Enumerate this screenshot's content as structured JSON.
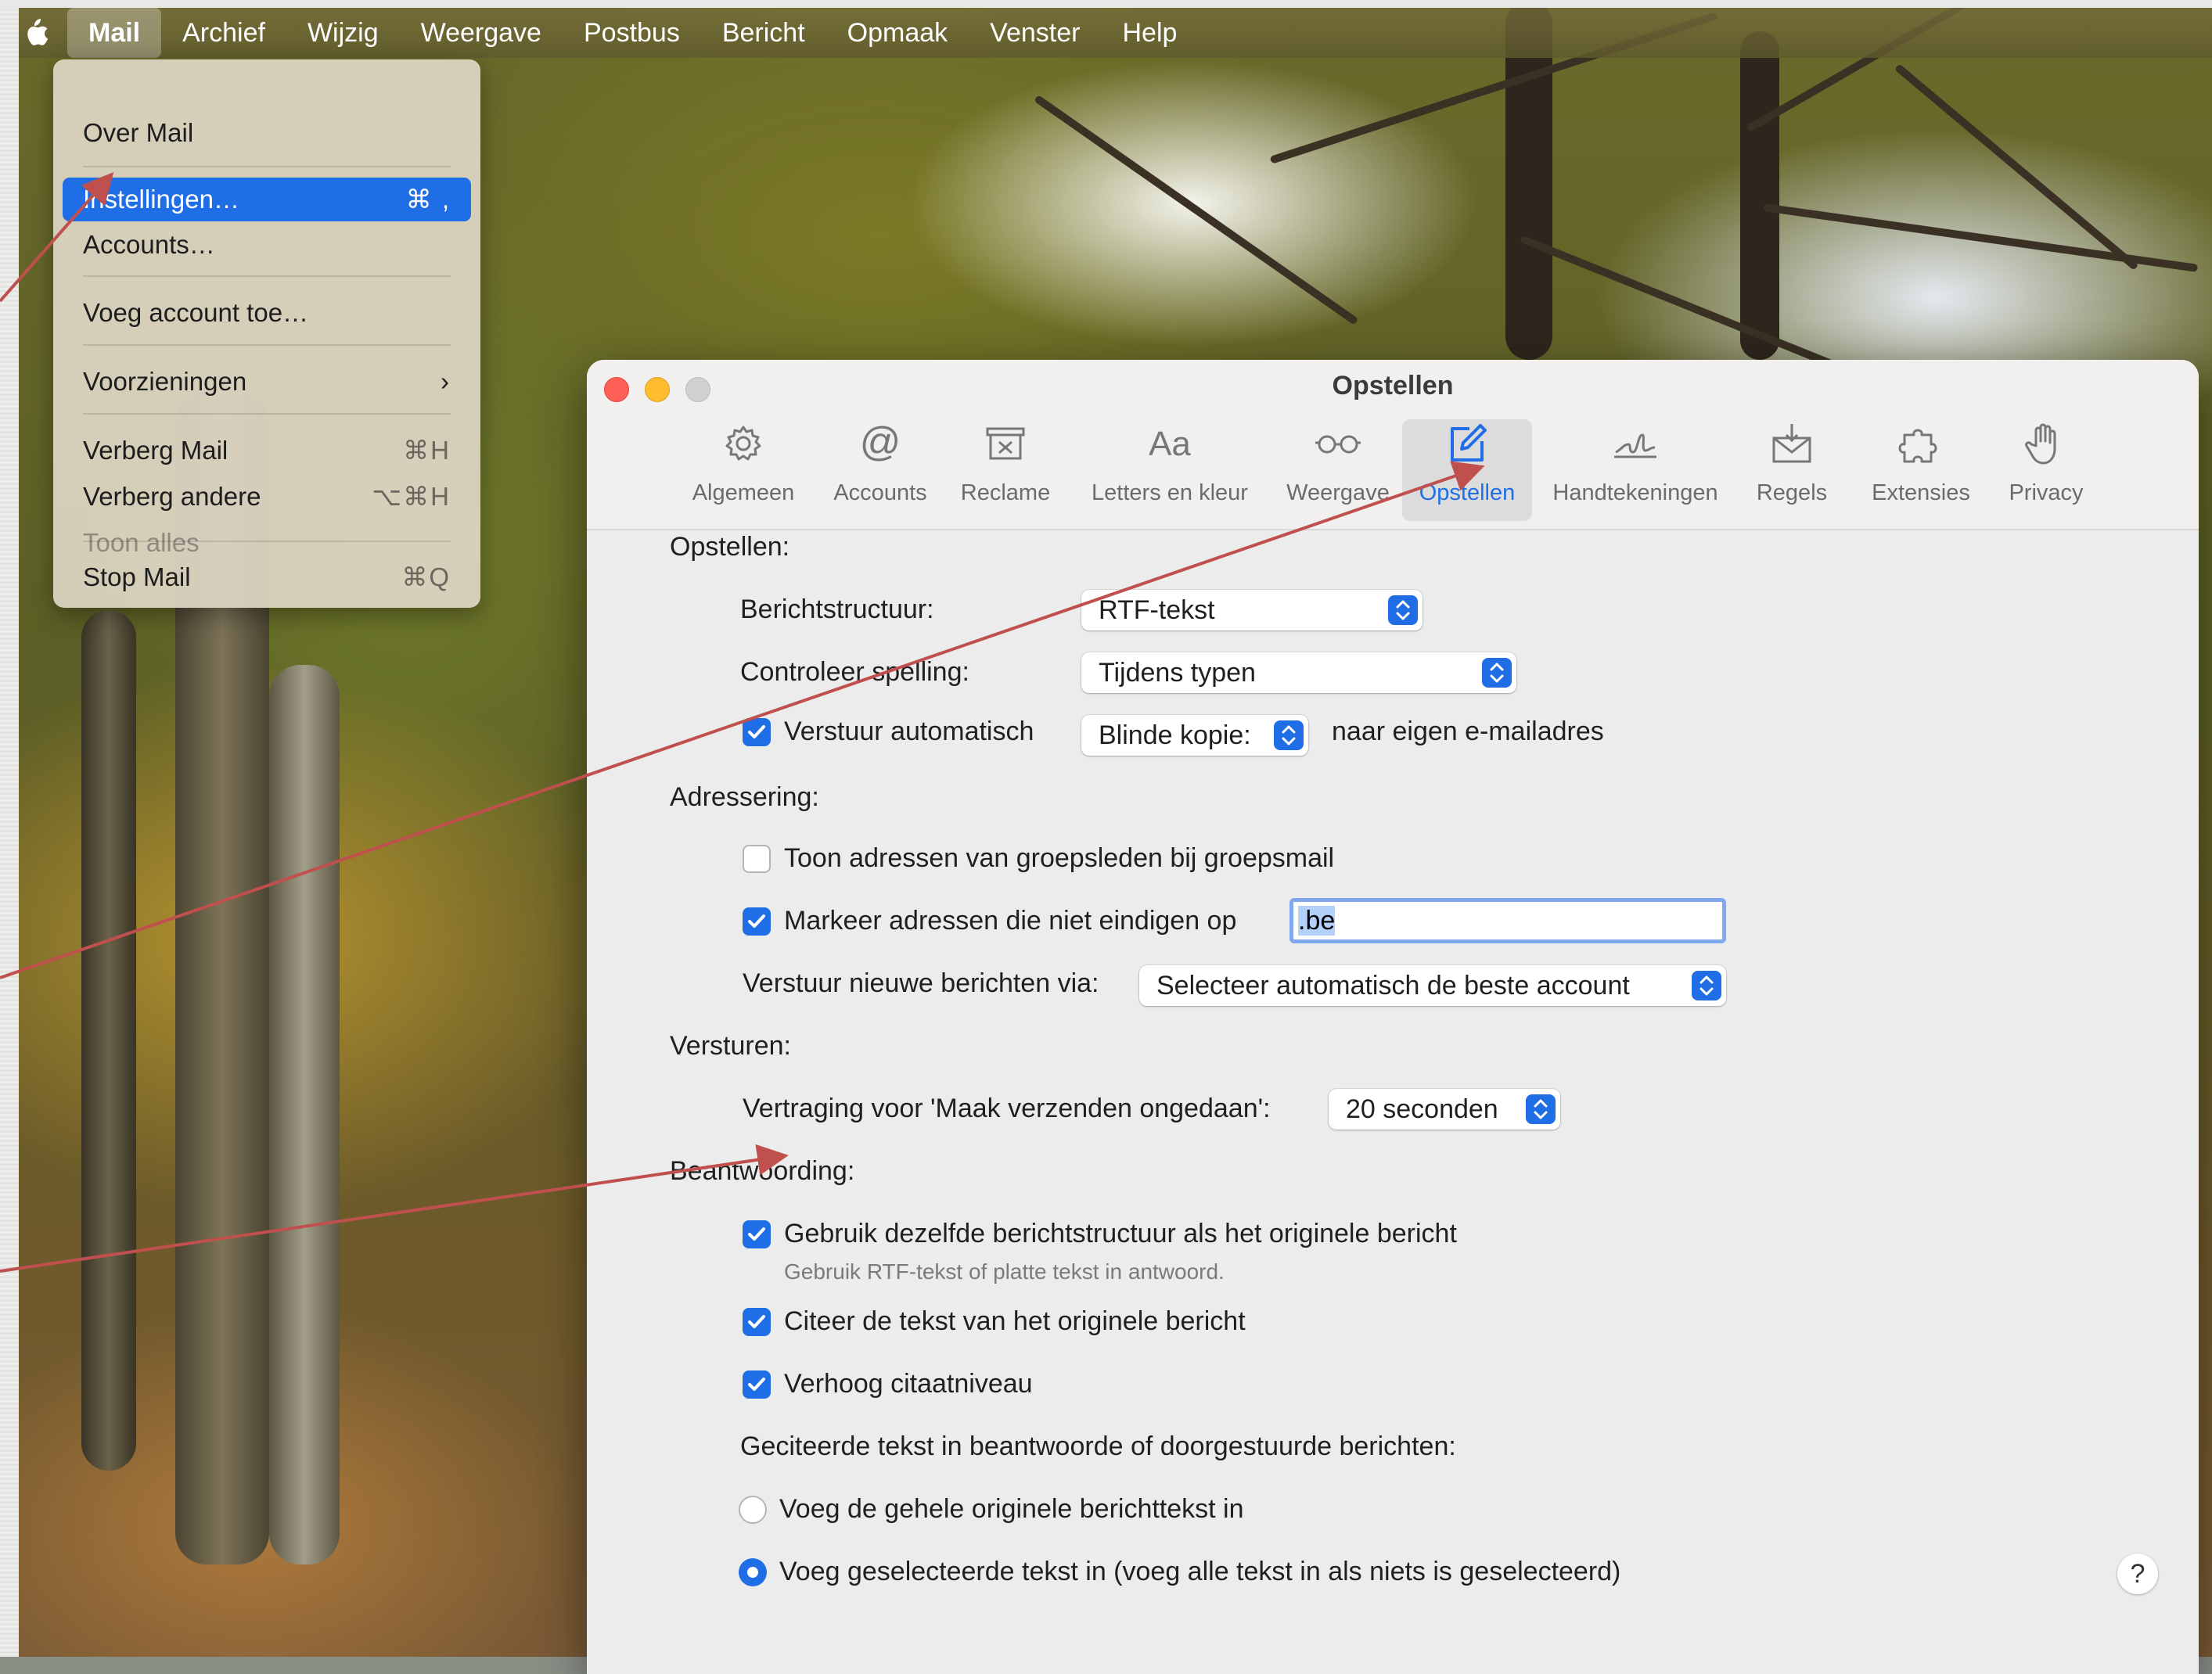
{
  "menubar": {
    "items": [
      "Mail",
      "Archief",
      "Wijzig",
      "Weergave",
      "Postbus",
      "Bericht",
      "Opmaak",
      "Venster",
      "Help"
    ]
  },
  "mail_menu": {
    "about": "Over Mail",
    "settings": "Instellingen…",
    "settings_shortcut": "⌘ ,",
    "accounts": "Accounts…",
    "add_account": "Voeg account toe…",
    "services": "Voorzieningen",
    "services_arrow": "›",
    "hide_mail": "Verberg Mail",
    "hide_mail_shortcut": "⌘H",
    "hide_others": "Verberg andere",
    "hide_others_shortcut": "⌥⌘H",
    "show_all": "Toon alles",
    "quit": "Stop Mail",
    "quit_shortcut": "⌘Q"
  },
  "window": {
    "title": "Opstellen",
    "toolbar": [
      {
        "label": "Algemeen",
        "icon": "gear-icon"
      },
      {
        "label": "Accounts",
        "icon": "at-icon"
      },
      {
        "label": "Reclame",
        "icon": "junk-tray-icon"
      },
      {
        "label": "Letters en kleur",
        "icon": "font-aa-icon"
      },
      {
        "label": "Weergave",
        "icon": "glasses-icon"
      },
      {
        "label": "Opstellen",
        "icon": "compose-icon",
        "selected": true
      },
      {
        "label": "Handtekeningen",
        "icon": "signature-icon"
      },
      {
        "label": "Regels",
        "icon": "rules-envelope-icon"
      },
      {
        "label": "Extensies",
        "icon": "puzzle-icon"
      },
      {
        "label": "Privacy",
        "icon": "hand-icon"
      }
    ],
    "help_label": "?"
  },
  "compose": {
    "section_compose": "Opstellen:",
    "format_label": "Berichtstructuur:",
    "format_value": "RTF-tekst",
    "spelling_label": "Controleer spelling:",
    "spelling_value": "Tijdens typen",
    "auto_send_label": "Verstuur automatisch",
    "auto_send_checked": true,
    "auto_send_value": "Blinde kopie:",
    "auto_send_suffix": "naar eigen e-mailadres",
    "section_addressing": "Adressering:",
    "show_group_label": "Toon adressen van groepsleden bij groepsmail",
    "show_group_checked": false,
    "mark_addresses_label": "Markeer adressen die niet eindigen op",
    "mark_addresses_checked": true,
    "mark_addresses_value": ".be",
    "send_via_label": "Verstuur nieuwe berichten via:",
    "send_via_value": "Selecteer automatisch de beste account",
    "section_sending": "Versturen:",
    "undo_delay_label": "Vertraging voor 'Maak verzenden ongedaan':",
    "undo_delay_value": "20 seconden",
    "section_responding": "Beantwoording:",
    "same_format_label": "Gebruik dezelfde berichtstructuur als het originele bericht",
    "same_format_checked": true,
    "same_format_hint": "Gebruik RTF-tekst of platte tekst in antwoord.",
    "quote_label": "Citeer de tekst van het originele bericht",
    "quote_checked": true,
    "increase_quote_label": "Verhoog citaatniveau",
    "increase_quote_checked": true,
    "quoted_text_label": "Geciteerde tekst in beantwoorde of doorgestuurde berichten:",
    "include_all_label": "Voeg de gehele originele berichttekst in",
    "include_all_selected": false,
    "include_selected_label": "Voeg geselecteerde tekst in (voeg alle tekst in als niets is geselecteerd)",
    "include_selected_selected": true
  },
  "colors": {
    "accent": "#1f6ee6",
    "annotation_arrow": "#c0504d"
  }
}
